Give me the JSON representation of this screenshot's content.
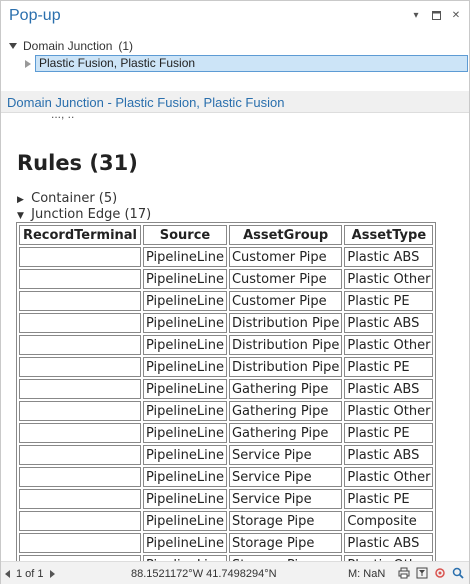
{
  "pane": {
    "title": "Pop-up",
    "icons": [
      "chevron-down-icon",
      "maximize-icon",
      "close-icon"
    ]
  },
  "tree": {
    "root_label": "Domain Junction",
    "root_count": "(1)",
    "selected_item": "Plastic Fusion, Plastic Fusion"
  },
  "subheader": {
    "text": "Domain Junction - Plastic Fusion, Plastic Fusion"
  },
  "content": {
    "cut_text": "..., ..",
    "rules_heading": "Rules (31)",
    "groups": [
      {
        "label": "Container (5)",
        "expanded": false
      },
      {
        "label": "Junction Edge (17)",
        "expanded": true
      }
    ],
    "table": {
      "columns": [
        "RecordTerminal",
        "Source",
        "AssetGroup",
        "AssetType"
      ],
      "rows": [
        [
          "",
          "PipelineLine",
          "Customer Pipe",
          "Plastic ABS"
        ],
        [
          "",
          "PipelineLine",
          "Customer Pipe",
          "Plastic Other"
        ],
        [
          "",
          "PipelineLine",
          "Customer Pipe",
          "Plastic PE"
        ],
        [
          "",
          "PipelineLine",
          "Distribution Pipe",
          "Plastic ABS"
        ],
        [
          "",
          "PipelineLine",
          "Distribution Pipe",
          "Plastic Other"
        ],
        [
          "",
          "PipelineLine",
          "Distribution Pipe",
          "Plastic PE"
        ],
        [
          "",
          "PipelineLine",
          "Gathering Pipe",
          "Plastic ABS"
        ],
        [
          "",
          "PipelineLine",
          "Gathering Pipe",
          "Plastic Other"
        ],
        [
          "",
          "PipelineLine",
          "Gathering Pipe",
          "Plastic PE"
        ],
        [
          "",
          "PipelineLine",
          "Service Pipe",
          "Plastic ABS"
        ],
        [
          "",
          "PipelineLine",
          "Service Pipe",
          "Plastic Other"
        ],
        [
          "",
          "PipelineLine",
          "Service Pipe",
          "Plastic PE"
        ],
        [
          "",
          "PipelineLine",
          "Storage Pipe",
          "Composite"
        ],
        [
          "",
          "PipelineLine",
          "Storage Pipe",
          "Plastic ABS"
        ],
        [
          "",
          "PipelineLine",
          "Storage Pipe",
          "Plastic Other"
        ]
      ]
    }
  },
  "statusbar": {
    "page": "1 of 1",
    "coords": "88.1521172°W 41.7498294°N",
    "m_value": "M: NaN",
    "icons": [
      "print-icon",
      "filter-icon",
      "snapping-icon",
      "zoom-icon"
    ]
  },
  "colors": {
    "accent": "#2a6fad",
    "selection_bg": "#cce4f7",
    "selection_border": "#5d9bd4"
  }
}
